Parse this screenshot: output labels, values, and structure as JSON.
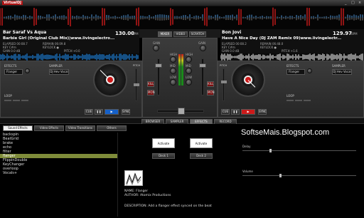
{
  "app": {
    "logo": "VirtualDJ"
  },
  "window_controls": [
    "_",
    "□",
    "×"
  ],
  "left_deck": {
    "artist": "Bar Saraf Vs Aqua",
    "bpm": "130.00",
    "bpm_suffix": "BPM",
    "title": "Barbie Girl (Original Club Mix)|www.livingelectro...",
    "elapsed": "ELAPSED 00:08.7",
    "remain": "REMAIN 06:09.8",
    "key": "KEY C#m",
    "gain": "GAIN 0.0 dB",
    "keylock": "KEYLOCK ●",
    "pitch": "PITCH +0.0",
    "effects_label": "EFFECTS",
    "effect_value": "Flanger",
    "sampler_label": "SAMPLER",
    "sampler_value": "DJ Hev Vocal",
    "loop_label": "LOOP",
    "cue": "CUE",
    "pause": "❚❚",
    "play": "▶",
    "sync": "SYNC",
    "pitch_label": "PITCH"
  },
  "right_deck": {
    "artist": "Bon Jovi",
    "bpm": "129.97",
    "bpm_suffix": "BPM",
    "title": "Have A Nice Day (DJ ZAM Remix 09)www.livingelectr...",
    "elapsed": "ELAPSED 00:08.2",
    "remain": "REMAIN 06:48.0",
    "key": "KEY C#m",
    "gain": "GAIN 0.0 dB",
    "keylock": "KEYLOCK ●",
    "pitch": "PITCH +1.6",
    "effects_label": "EFFECTS",
    "effect_value": "Flanger",
    "sampler_label": "SAMPLER",
    "sampler_value": "DJ Hev Vocal",
    "loop_label": "LOOP",
    "cue": "CUE",
    "pause": "❚❚",
    "play": "▶",
    "sync": "SYNC",
    "pitch_label": "PITCH"
  },
  "mixer": {
    "tabs": [
      "MIXER",
      "VIDEO",
      "SCRATCH"
    ],
    "active_tab": 0,
    "left_labels": [
      "GAIN",
      "HIGH",
      "MID",
      "LOW"
    ],
    "right_labels": [
      "GAIN",
      "HIGH",
      "MID",
      "LOW"
    ],
    "kill": "KILL",
    "mon": "MON"
  },
  "browser_tabs": [
    "BROWSER",
    "SAMPLER",
    "EFFECTS",
    "RECORD"
  ],
  "active_browser_tab": 2,
  "effect_tabs": [
    "Sound Effects",
    "Video Effects",
    "Video Transitions",
    "Others"
  ],
  "effects_list": [
    "backspin",
    "BeatGrid",
    "brake",
    "echo",
    "filter",
    "flanger",
    "FlippinDouble",
    "KeyChanger",
    "overloop",
    "Vocals+"
  ],
  "selected_effect_index": 5,
  "effect_panel": {
    "activate1": "Activate",
    "activate2": "Activate",
    "deck1": "Deck 1",
    "deck2": "Deck 2",
    "name": "NAME: Flanger",
    "author": "AUTHOR: Atomix Productions",
    "description": "DESCRIPTION: Add a flanger effect synced on the beat",
    "delay_label": "Delay",
    "volume_label": "Volume"
  },
  "watermark": "SoftseMais.Blogspot.com",
  "colors": {
    "left_wave": "#1f7fd6",
    "right_wave": "#d8d8d8",
    "accent_red": "#cc1a1a",
    "panel": "#2e2e2e"
  }
}
